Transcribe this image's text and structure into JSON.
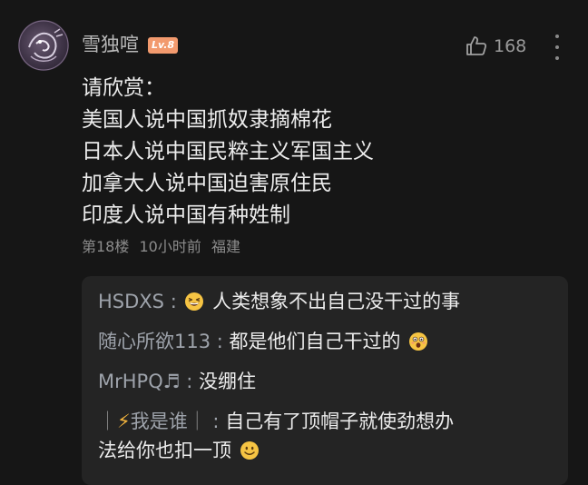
{
  "comment": {
    "username": "雪独喧",
    "level_badge": "Lv.8",
    "like_count": "168",
    "body_lines": [
      "请欣赏：",
      "美国人说中国抓奴隶摘棉花",
      "日本人说中国民粹主义军国主义",
      "加拿大人说中国迫害原住民",
      "印度人说中国有种姓制"
    ],
    "floor": "第18楼",
    "time_ago": "10小时前",
    "location": "福建"
  },
  "replies": [
    {
      "user": "HSDXS",
      "sep": " :",
      "emoji": "grinning-squint-emoji",
      "text": " 人类想象不出自己没干过的事"
    },
    {
      "user": "随心所欲113",
      "sep": " : ",
      "text": "都是他们自己干过的",
      "emoji": "astonished-emoji"
    },
    {
      "user": "MrHPQ♬",
      "sep": " : ",
      "text": "没绷住"
    },
    {
      "user_prefix": "｜⚡",
      "user": "我是谁",
      "user_suffix": "｜",
      "sep": " : ",
      "text": "自己有了顶帽子就使劲想办",
      "text_cont": "法给你也扣一顶",
      "emoji": "smiley-emoji"
    }
  ],
  "icons": {
    "like": "thumbs-up-icon",
    "more": "more-vertical-icon"
  },
  "colors": {
    "background": "#161616",
    "reply_background": "#242424",
    "level_badge": "#f29a6e",
    "muted_text": "#8c8c8c"
  }
}
